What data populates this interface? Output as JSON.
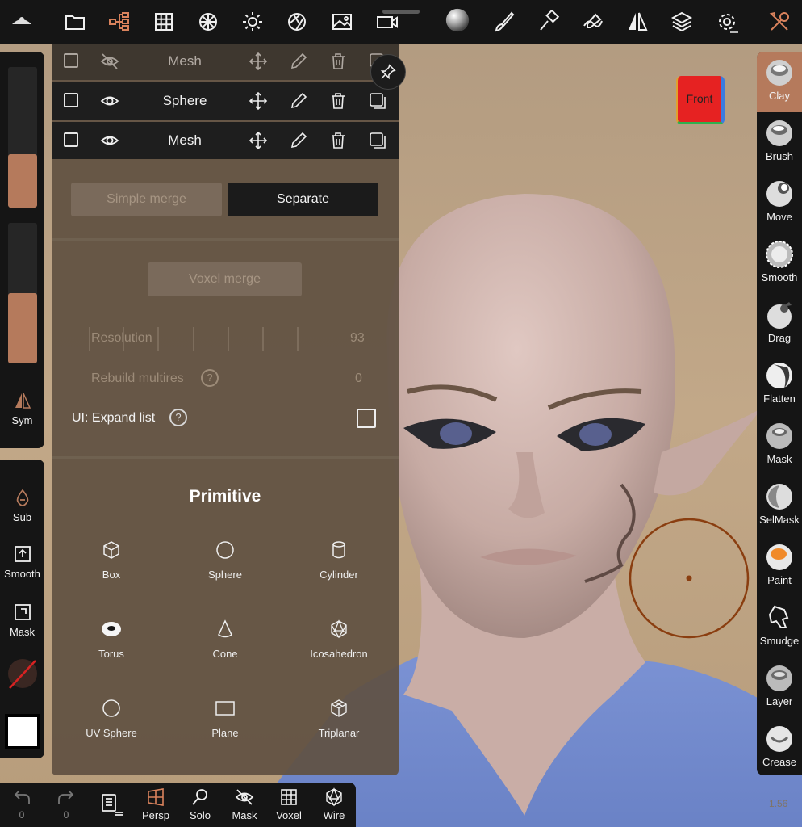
{
  "top_toolbar": {
    "icons": [
      "app-logo-icon",
      "folder-icon",
      "scene-tree-icon",
      "grid-icon",
      "topology-icon",
      "light-icon",
      "camera-aperture-icon",
      "image-icon",
      "video-icon",
      "material-sphere-icon",
      "brush-icon",
      "hammer-icon",
      "stroke-icon",
      "symmetry-icon",
      "layers-icon",
      "settings-icon",
      "tools-icon"
    ]
  },
  "mesh_list": [
    {
      "name": "Mesh",
      "visible": false
    },
    {
      "name": "Sphere",
      "visible": true
    },
    {
      "name": "Mesh",
      "visible": true
    }
  ],
  "merge": {
    "simple_merge_label": "Simple merge",
    "separate_label": "Separate",
    "voxel_merge_label": "Voxel merge"
  },
  "settings": {
    "resolution_label": "Resolution",
    "resolution_value": "93",
    "rebuild_label": "Rebuild multires",
    "rebuild_value": "0",
    "expand_label": "UI: Expand list",
    "help_glyph": "?"
  },
  "primitive": {
    "title": "Primitive",
    "items": [
      "Box",
      "Sphere",
      "Cylinder",
      "Torus",
      "Cone",
      "Icosahedron",
      "UV Sphere",
      "Plane",
      "Triplanar"
    ]
  },
  "left_tools": {
    "sym_label": "Sym",
    "sub_label": "Sub",
    "smooth_label": "Smooth",
    "mask_label": "Mask",
    "slider_radius": 0.38,
    "slider_intensity": 0.5
  },
  "right_tools": [
    "Clay",
    "Brush",
    "Move",
    "Smooth",
    "Drag",
    "Flatten",
    "Mask",
    "SelMask",
    "Paint",
    "Smudge",
    "Layer",
    "Crease"
  ],
  "bottom_bar": {
    "undo_count": "0",
    "redo_count": "0",
    "items": [
      "Persp",
      "Solo",
      "Mask",
      "Voxel",
      "Wire"
    ]
  },
  "view_cube_label": "Front",
  "version": "1.56",
  "colors": {
    "accent": "#b57a5c",
    "toolbar_bg": "#151515",
    "panel_bg": "#605041"
  }
}
